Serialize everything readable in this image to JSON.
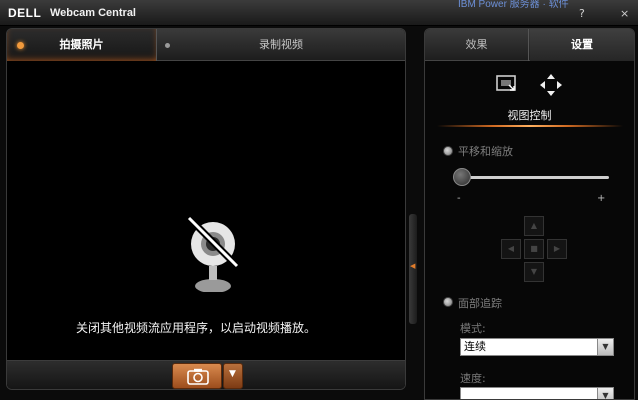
{
  "window": {
    "logo": "DELL",
    "title": "Webcam Central",
    "background_text": "IBM Power 服务器 · 软件",
    "help_glyph": "?",
    "close_glyph": "×"
  },
  "capture_tabs": [
    {
      "label": "拍摄照片",
      "active": true
    },
    {
      "label": "录制视频",
      "active": false
    }
  ],
  "preview": {
    "message": "关闭其他视频流应用程序，以启动视频播放。",
    "icon": "webcam-disabled-icon"
  },
  "controls": {
    "capture_icon": "camera-icon",
    "dropdown_glyph": "▼"
  },
  "settings_tabs": [
    {
      "label": "效果",
      "active": false
    },
    {
      "label": "设置",
      "active": true
    }
  ],
  "view_control": {
    "title": "视图控制",
    "icons": [
      "fit-frame-icon",
      "move-arrows-icon"
    ],
    "pan_zoom": {
      "label": "平移和缩放",
      "min_label": "-",
      "max_label": "+",
      "level": 0
    },
    "dpad_glyphs": {
      "up": "▲",
      "down": "▼",
      "left": "◀",
      "right": "▶",
      "center": "■"
    },
    "face_tracking": {
      "label": "面部追踪",
      "mode_label": "模式:",
      "mode_value": "连续",
      "speed_label": "速度:",
      "speed_value": ""
    }
  },
  "colors": {
    "accent": "#e07c2b",
    "background": "#000000",
    "panel": "#1f1f1f"
  }
}
